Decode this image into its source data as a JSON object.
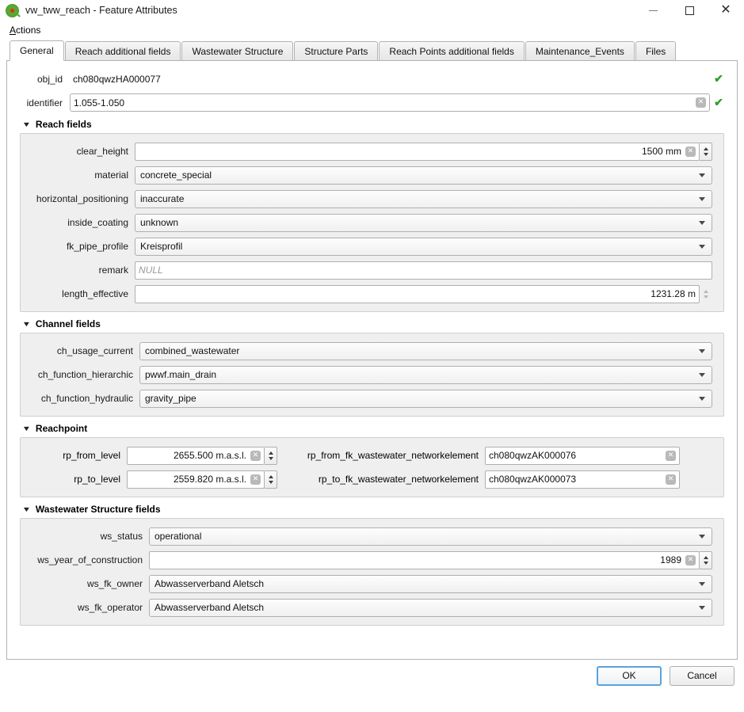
{
  "window": {
    "title": "vw_tww_reach - Feature Attributes",
    "logo_icon": "qgis-logo-icon",
    "minimize_icon": "minimize-icon",
    "maximize_icon": "maximize-icon",
    "close_icon": "close-icon"
  },
  "menubar": {
    "items": [
      {
        "label": "Actions",
        "mnemonic": "A"
      }
    ]
  },
  "tabs": [
    {
      "label": "General",
      "active": true
    },
    {
      "label": "Reach additional fields",
      "active": false
    },
    {
      "label": "Wastewater Structure",
      "active": false
    },
    {
      "label": "Structure Parts",
      "active": false
    },
    {
      "label": "Reach Points additional fields",
      "active": false
    },
    {
      "label": "Maintenance_Events",
      "active": false
    },
    {
      "label": "Files",
      "active": false
    }
  ],
  "top_fields": [
    {
      "label": "obj_id",
      "value": "ch080qwzHA000077",
      "style": "flat",
      "valid_icon": "check-icon",
      "clear_icon": null
    },
    {
      "label": "identifier",
      "value": "1.055-1.050",
      "style": "boxed",
      "valid_icon": "check-icon",
      "clear_icon": "clear-icon"
    }
  ],
  "sections": [
    {
      "title": "Reach fields",
      "collapse_icon": "triangle-down-icon",
      "label_width": 130,
      "rows": [
        {
          "label": "clear_height",
          "widget": "spinbox",
          "value": "1500 mm",
          "align": "right",
          "clear_icon": "clear-icon",
          "spinner": "active"
        },
        {
          "label": "material",
          "widget": "combobox",
          "value": "concrete_special",
          "arrow_icon": "chevron-down-icon"
        },
        {
          "label": "horizontal_positioning",
          "widget": "combobox",
          "value": "inaccurate",
          "arrow_icon": "chevron-down-icon"
        },
        {
          "label": "inside_coating",
          "widget": "combobox",
          "value": "unknown",
          "arrow_icon": "chevron-down-icon"
        },
        {
          "label": "fk_pipe_profile",
          "widget": "combobox",
          "value": "Kreisprofil",
          "arrow_icon": "chevron-down-icon"
        },
        {
          "label": "remark",
          "widget": "lineedit",
          "value": "",
          "placeholder": "NULL",
          "align": "left"
        },
        {
          "label": "length_effective",
          "widget": "spinbox",
          "value": "1231.28 m",
          "align": "right",
          "clear_icon": null,
          "spinner": "dim"
        }
      ]
    },
    {
      "title": "Channel fields",
      "collapse_icon": "triangle-down-icon",
      "label_width": 136,
      "rows": [
        {
          "label": "ch_usage_current",
          "widget": "combobox",
          "value": "combined_wastewater",
          "arrow_icon": "chevron-down-icon"
        },
        {
          "label": "ch_function_hierarchic",
          "widget": "combobox",
          "value": "pwwf.main_drain",
          "arrow_icon": "chevron-down-icon"
        },
        {
          "label": "ch_function_hydraulic",
          "widget": "combobox",
          "value": "gravity_pipe",
          "arrow_icon": "chevron-down-icon"
        }
      ]
    },
    {
      "title": "Wastewater Structure fields",
      "collapse_icon": "triangle-down-icon",
      "label_width": 148,
      "rows": [
        {
          "label": "ws_status",
          "widget": "combobox",
          "value": "operational",
          "arrow_icon": "chevron-down-icon"
        },
        {
          "label": "ws_year_of_construction",
          "widget": "spinbox",
          "value": "1989",
          "align": "right",
          "clear_icon": "clear-icon",
          "spinner": "active"
        },
        {
          "label": "ws_fk_owner",
          "widget": "combobox",
          "value": "Abwasserverband Aletsch",
          "arrow_icon": "chevron-down-icon"
        },
        {
          "label": "ws_fk_operator",
          "widget": "combobox",
          "value": "Abwasserverband Aletsch",
          "arrow_icon": "chevron-down-icon"
        }
      ]
    }
  ],
  "reachpoint": {
    "title": "Reachpoint",
    "collapse_icon": "triangle-down-icon",
    "rows": [
      {
        "left_label": "rp_from_level",
        "left_value": "2655.500 m.a.s.l.",
        "left_clear_icon": "clear-icon",
        "left_spinner": "active",
        "right_label": "rp_from_fk_wastewater_networkelement",
        "right_value": "ch080qwzAK000076",
        "right_clear_icon": "clear-icon"
      },
      {
        "left_label": "rp_to_level",
        "left_value": "2559.820 m.a.s.l.",
        "left_clear_icon": "clear-icon",
        "left_spinner": "active",
        "right_label": "rp_to_fk_wastewater_networkelement",
        "right_value": "ch080qwzAK000073",
        "right_clear_icon": "clear-icon"
      }
    ]
  },
  "buttons": {
    "ok": "OK",
    "cancel": "Cancel"
  },
  "colors": {
    "valid_green": "#2f9e2f",
    "focus_blue": "#5aa3dd",
    "group_bg": "#efefef"
  }
}
